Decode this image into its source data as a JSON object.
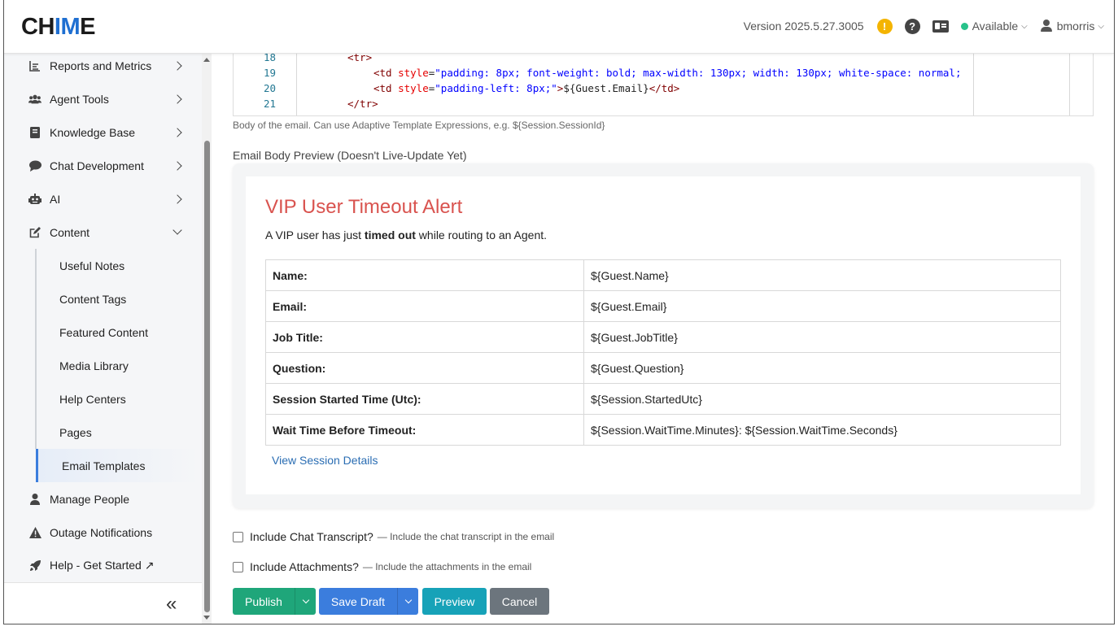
{
  "app": {
    "logo_pre": "CH",
    "logo_mid": "IM",
    "logo_post": "E"
  },
  "header": {
    "version": "Version 2025.5.27.3005",
    "warning_icon": "!",
    "help_icon": "?",
    "status": "Available",
    "status_color": "#28c28a",
    "username": "bmorris"
  },
  "sidebar": {
    "items": [
      {
        "label": "Reports and Metrics",
        "icon": "chart-icon"
      },
      {
        "label": "Agent Tools",
        "icon": "users-icon"
      },
      {
        "label": "Knowledge Base",
        "icon": "book-icon"
      },
      {
        "label": "Chat Development",
        "icon": "chat-bubble-icon"
      },
      {
        "label": "AI",
        "icon": "robot-icon"
      },
      {
        "label": "Content",
        "icon": "edit-icon"
      }
    ],
    "content_children": [
      "Useful Notes",
      "Content Tags",
      "Featured Content",
      "Media Library",
      "Help Centers",
      "Pages",
      "Email Templates"
    ],
    "active_child": "Email Templates",
    "bottom_items": [
      {
        "label": "Manage People",
        "icon": "person-icon"
      },
      {
        "label": "Outage Notifications",
        "icon": "warning-triangle-icon"
      },
      {
        "label": "Help - Get Started ↗",
        "icon": "rocket-icon"
      }
    ],
    "collapse_glyph": "«"
  },
  "editor": {
    "lines": [
      {
        "num": "18",
        "code": "<tr>"
      },
      {
        "num": "19",
        "code": "<td style=\"padding: 8px; font-weight: bold; max-width: 130px; width: 130px; white-space: normal;"
      },
      {
        "num": "20",
        "code": "<td style=\"padding-left: 8px;\">${Guest.Email}</td>"
      },
      {
        "num": "21",
        "code": "</tr>"
      }
    ],
    "help_text": "Body of the email. Can use Adaptive Template Expressions, e.g. ${Session.SessionId}"
  },
  "preview": {
    "label": "Email Body Preview (Doesn't Live-Update Yet)",
    "title": "VIP User Timeout Alert",
    "intro_pre": "A VIP user has just ",
    "intro_bold": "timed out",
    "intro_post": " while routing to an Agent.",
    "title_color": "#d9534f",
    "rows": [
      {
        "key": "Name:",
        "value": "${Guest.Name}"
      },
      {
        "key": "Email:",
        "value": "${Guest.Email}"
      },
      {
        "key": "Job Title:",
        "value": "${Guest.JobTitle}"
      },
      {
        "key": "Question:",
        "value": "${Guest.Question}"
      },
      {
        "key": "Session Started Time (Utc):",
        "value": "${Session.StartedUtc}"
      },
      {
        "key": "Wait Time Before Timeout:",
        "value": "${Session.WaitTime.Minutes}: ${Session.WaitTime.Seconds}"
      }
    ],
    "link": "View Session Details"
  },
  "options": {
    "transcript_label": "Include Chat Transcript?",
    "transcript_desc": "— Include the chat transcript in the email",
    "attachments_label": "Include Attachments?",
    "attachments_desc": "— Include the attachments in the email"
  },
  "actions": {
    "publish": "Publish",
    "save_draft": "Save Draft",
    "preview": "Preview",
    "cancel": "Cancel"
  }
}
